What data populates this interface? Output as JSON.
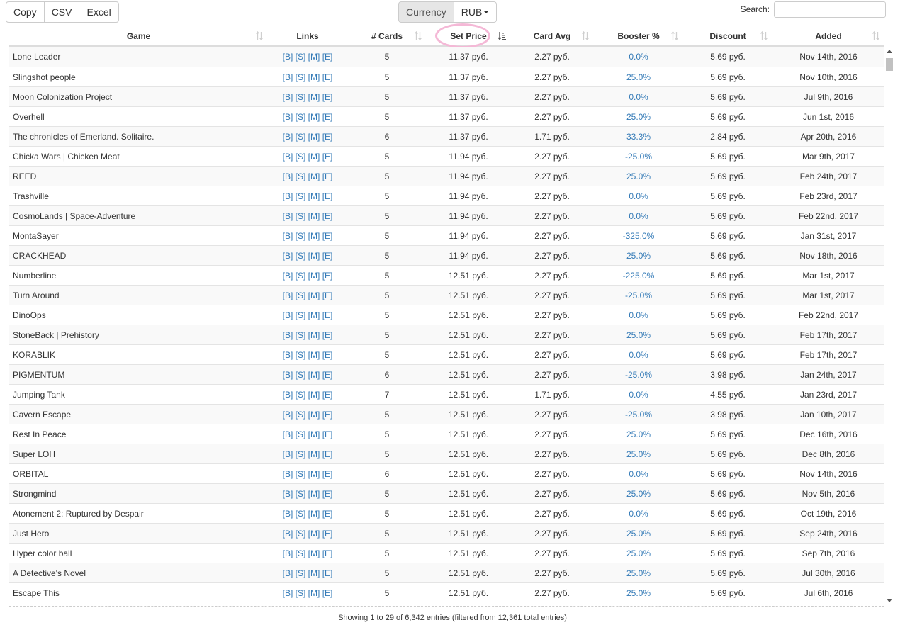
{
  "toolbar": {
    "export_buttons": [
      "Copy",
      "CSV",
      "Excel"
    ],
    "currency_label": "Currency",
    "currency_value": "RUB",
    "search_label": "Search:",
    "search_value": ""
  },
  "columns": [
    "Game",
    "Links",
    "# Cards",
    "Set Price",
    "Card Avg",
    "Booster %",
    "Discount",
    "Added"
  ],
  "sorted_column": "Set Price",
  "sorted_direction": "ascending",
  "links_text": [
    "[B]",
    "[S]",
    "[M]",
    "[E]"
  ],
  "rows": [
    {
      "game": "Lone Leader",
      "cards": "5",
      "set_price": "11.37 руб.",
      "card_avg": "2.27 руб.",
      "booster": "0.0%",
      "discount": "5.69 руб.",
      "added": "Nov 14th, 2016"
    },
    {
      "game": "Slingshot people",
      "cards": "5",
      "set_price": "11.37 руб.",
      "card_avg": "2.27 руб.",
      "booster": "25.0%",
      "discount": "5.69 руб.",
      "added": "Nov 10th, 2016"
    },
    {
      "game": "Moon Colonization Project",
      "cards": "5",
      "set_price": "11.37 руб.",
      "card_avg": "2.27 руб.",
      "booster": "0.0%",
      "discount": "5.69 руб.",
      "added": "Jul 9th, 2016"
    },
    {
      "game": "Overhell",
      "cards": "5",
      "set_price": "11.37 руб.",
      "card_avg": "2.27 руб.",
      "booster": "25.0%",
      "discount": "5.69 руб.",
      "added": "Jun 1st, 2016"
    },
    {
      "game": "The chronicles of Emerland. Solitaire.",
      "cards": "6",
      "set_price": "11.37 руб.",
      "card_avg": "1.71 руб.",
      "booster": "33.3%",
      "discount": "2.84 руб.",
      "added": "Apr 20th, 2016"
    },
    {
      "game": "Chicka Wars | Chicken Meat",
      "cards": "5",
      "set_price": "11.94 руб.",
      "card_avg": "2.27 руб.",
      "booster": "-25.0%",
      "discount": "5.69 руб.",
      "added": "Mar 9th, 2017"
    },
    {
      "game": "REED",
      "cards": "5",
      "set_price": "11.94 руб.",
      "card_avg": "2.27 руб.",
      "booster": "25.0%",
      "discount": "5.69 руб.",
      "added": "Feb 24th, 2017"
    },
    {
      "game": "Trashville",
      "cards": "5",
      "set_price": "11.94 руб.",
      "card_avg": "2.27 руб.",
      "booster": "0.0%",
      "discount": "5.69 руб.",
      "added": "Feb 23rd, 2017"
    },
    {
      "game": "CosmoLands | Space-Adventure",
      "cards": "5",
      "set_price": "11.94 руб.",
      "card_avg": "2.27 руб.",
      "booster": "0.0%",
      "discount": "5.69 руб.",
      "added": "Feb 22nd, 2017"
    },
    {
      "game": "MontaSayer",
      "cards": "5",
      "set_price": "11.94 руб.",
      "card_avg": "2.27 руб.",
      "booster": "-325.0%",
      "discount": "5.69 руб.",
      "added": "Jan 31st, 2017"
    },
    {
      "game": "CRACKHEAD",
      "cards": "5",
      "set_price": "11.94 руб.",
      "card_avg": "2.27 руб.",
      "booster": "25.0%",
      "discount": "5.69 руб.",
      "added": "Nov 18th, 2016"
    },
    {
      "game": "Numberline",
      "cards": "5",
      "set_price": "12.51 руб.",
      "card_avg": "2.27 руб.",
      "booster": "-225.0%",
      "discount": "5.69 руб.",
      "added": "Mar 1st, 2017"
    },
    {
      "game": "Turn Around",
      "cards": "5",
      "set_price": "12.51 руб.",
      "card_avg": "2.27 руб.",
      "booster": "-25.0%",
      "discount": "5.69 руб.",
      "added": "Mar 1st, 2017"
    },
    {
      "game": "DinoOps",
      "cards": "5",
      "set_price": "12.51 руб.",
      "card_avg": "2.27 руб.",
      "booster": "0.0%",
      "discount": "5.69 руб.",
      "added": "Feb 22nd, 2017"
    },
    {
      "game": "StoneBack | Prehistory",
      "cards": "5",
      "set_price": "12.51 руб.",
      "card_avg": "2.27 руб.",
      "booster": "25.0%",
      "discount": "5.69 руб.",
      "added": "Feb 17th, 2017"
    },
    {
      "game": "KORABLIK",
      "cards": "5",
      "set_price": "12.51 руб.",
      "card_avg": "2.27 руб.",
      "booster": "0.0%",
      "discount": "5.69 руб.",
      "added": "Feb 17th, 2017"
    },
    {
      "game": "PIGMENTUM",
      "cards": "6",
      "set_price": "12.51 руб.",
      "card_avg": "2.27 руб.",
      "booster": "-25.0%",
      "discount": "3.98 руб.",
      "added": "Jan 24th, 2017"
    },
    {
      "game": "Jumping Tank",
      "cards": "7",
      "set_price": "12.51 руб.",
      "card_avg": "1.71 руб.",
      "booster": "0.0%",
      "discount": "4.55 руб.",
      "added": "Jan 23rd, 2017"
    },
    {
      "game": "Cavern Escape",
      "cards": "5",
      "set_price": "12.51 руб.",
      "card_avg": "2.27 руб.",
      "booster": "-25.0%",
      "discount": "3.98 руб.",
      "added": "Jan 10th, 2017"
    },
    {
      "game": "Rest In Peace",
      "cards": "5",
      "set_price": "12.51 руб.",
      "card_avg": "2.27 руб.",
      "booster": "25.0%",
      "discount": "5.69 руб.",
      "added": "Dec 16th, 2016"
    },
    {
      "game": "Super LOH",
      "cards": "5",
      "set_price": "12.51 руб.",
      "card_avg": "2.27 руб.",
      "booster": "25.0%",
      "discount": "5.69 руб.",
      "added": "Dec 8th, 2016"
    },
    {
      "game": "ORBITAL",
      "cards": "6",
      "set_price": "12.51 руб.",
      "card_avg": "2.27 руб.",
      "booster": "0.0%",
      "discount": "5.69 руб.",
      "added": "Nov 14th, 2016"
    },
    {
      "game": "Strongmind",
      "cards": "5",
      "set_price": "12.51 руб.",
      "card_avg": "2.27 руб.",
      "booster": "25.0%",
      "discount": "5.69 руб.",
      "added": "Nov 5th, 2016"
    },
    {
      "game": "Atonement 2: Ruptured by Despair",
      "cards": "5",
      "set_price": "12.51 руб.",
      "card_avg": "2.27 руб.",
      "booster": "0.0%",
      "discount": "5.69 руб.",
      "added": "Oct 19th, 2016"
    },
    {
      "game": "Just Hero",
      "cards": "5",
      "set_price": "12.51 руб.",
      "card_avg": "2.27 руб.",
      "booster": "25.0%",
      "discount": "5.69 руб.",
      "added": "Sep 24th, 2016"
    },
    {
      "game": "Hyper color ball",
      "cards": "5",
      "set_price": "12.51 руб.",
      "card_avg": "2.27 руб.",
      "booster": "25.0%",
      "discount": "5.69 руб.",
      "added": "Sep 7th, 2016"
    },
    {
      "game": "A Detective's Novel",
      "cards": "5",
      "set_price": "12.51 руб.",
      "card_avg": "2.27 руб.",
      "booster": "25.0%",
      "discount": "5.69 руб.",
      "added": "Jul 30th, 2016"
    },
    {
      "game": "Escape This",
      "cards": "5",
      "set_price": "12.51 руб.",
      "card_avg": "2.27 руб.",
      "booster": "25.0%",
      "discount": "5.69 руб.",
      "added": "Jul 6th, 2016"
    }
  ],
  "footer": {
    "info": "Showing 1 to 29 of 6,342 entries (filtered from 12,361 total entries)"
  },
  "colors": {
    "link": "#337ab7",
    "highlight_ring": "#f4b8d6",
    "stripe": "#f9f9f9"
  }
}
